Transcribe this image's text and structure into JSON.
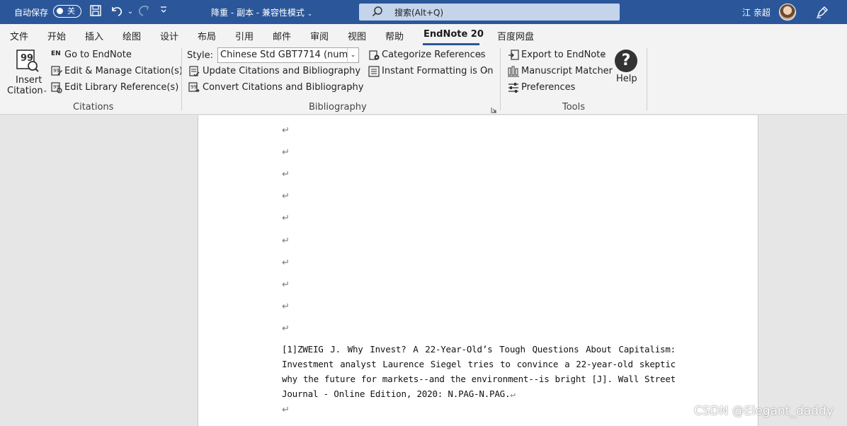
{
  "titlebar": {
    "autosave_label": "自动保存",
    "autosave_state": "关",
    "doc_title": "降重 - 副本 - 兼容性模式",
    "search_placeholder": "搜索(Alt+Q)",
    "user_name": "江 亲超"
  },
  "menu": {
    "tabs": [
      "文件",
      "开始",
      "插入",
      "绘图",
      "设计",
      "布局",
      "引用",
      "邮件",
      "审阅",
      "视图",
      "帮助",
      "EndNote 20",
      "百度网盘"
    ],
    "active": "EndNote 20"
  },
  "ribbon": {
    "citations": {
      "insert_line1": "Insert",
      "insert_line2": "Citation",
      "go_to": "Go to EndNote",
      "edit_manage": "Edit & Manage Citation(s)",
      "edit_library": "Edit Library Reference(s)",
      "group_label": "Citations"
    },
    "bibliography": {
      "style_label": "Style:",
      "style_value": "Chinese Std GBT7714 (numer...",
      "update": "Update Citations and Bibliography",
      "convert": "Convert Citations and Bibliography",
      "categorize": "Categorize References",
      "instant": "Instant Formatting is On",
      "group_label": "Bibliography"
    },
    "tools": {
      "export": "Export to EndNote",
      "manuscript": "Manuscript Matcher",
      "preferences": "Preferences",
      "help": "Help",
      "group_label": "Tools"
    }
  },
  "document": {
    "paragraph_mark": "↵",
    "reference_text": "[1]ZWEIG J. Why Invest? A 22-Year-Old’s Tough Questions About Capitalism: Investment analyst Laurence Siegel tries to convince a 22-year-old skeptic why the future for markets--and the environment--is bright [J]. Wall Street Journal - Online Edition, 2020: N.PAG-N.PAG."
  },
  "watermark": "CSDN @Elegant_daddy",
  "colors": {
    "titlebar": "#2b579a",
    "ribbon": "#f3f3f3",
    "page": "#ffffff"
  }
}
